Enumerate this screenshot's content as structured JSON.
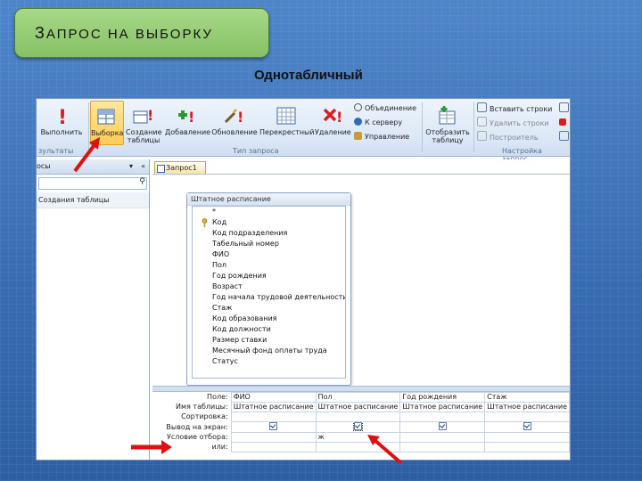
{
  "slide": {
    "title": "ЗАПРОС НА ВЫБОРКУ",
    "subtitle": "Однотабличный"
  },
  "ribbon": {
    "run_label": "Выполнить",
    "results_group": "зультаты",
    "buttons": [
      {
        "label": "Выборка",
        "icon": "select-query-icon"
      },
      {
        "label": "Создание таблицы",
        "icon": "make-table-icon"
      },
      {
        "label": "Добавление",
        "icon": "append-icon"
      },
      {
        "label": "Обновление",
        "icon": "update-icon"
      },
      {
        "label": "Перекрестный",
        "icon": "crosstab-icon"
      },
      {
        "label": "Удаление",
        "icon": "delete-icon"
      }
    ],
    "type_group": "Тип запроса",
    "small_items": [
      "Объединение",
      "К серверу",
      "Управление"
    ],
    "show_table_label": "Отобразить таблицу",
    "setup_items": [
      "Вставить строки",
      "Удалить строки",
      "Построитель"
    ],
    "setup_group": "Настройка запрос",
    "colors": {
      "accent": "#ffcc55",
      "ribbon": "#dce8f6"
    }
  },
  "nav": {
    "header": "осы",
    "item": "Создания таблицы"
  },
  "document": {
    "tab_label": "Запрос1",
    "table_name": "Штатное расписание",
    "fields": [
      "*",
      "Код",
      "Код подразделения",
      "Табельный номер",
      "ФИО",
      "Пол",
      "Год рождения",
      "Возраст",
      "Год начала трудовой деятельности",
      "Стаж",
      "Код образования",
      "Код должности",
      "Размер ставки",
      "Месячный фонд оплаты труда",
      "Статус"
    ]
  },
  "grid": {
    "row_labels": [
      "Поле:",
      "Имя таблицы:",
      "Сортировка:",
      "Вывод на экран:",
      "Условие отбора:",
      "или:"
    ],
    "columns": [
      {
        "field": "ФИО",
        "table": "Штатное расписание",
        "criteria": ""
      },
      {
        "field": "Пол",
        "table": "Штатное расписание",
        "criteria": "ж"
      },
      {
        "field": "Год рождения",
        "table": "Штатное расписание",
        "criteria": ""
      },
      {
        "field": "Стаж",
        "table": "Штатное расписание",
        "criteria": ""
      }
    ]
  }
}
